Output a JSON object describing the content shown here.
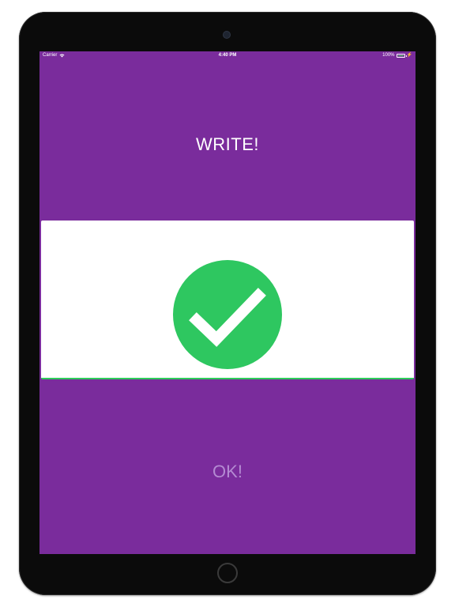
{
  "status_bar": {
    "carrier": "Carrier",
    "time": "4:40 PM",
    "battery_percent": "100%",
    "battery_level": 1.0,
    "wifi_icon": "wifi-icon",
    "charging_icon": "charging-bolt-icon"
  },
  "main": {
    "title": "WRITE!",
    "result_icon": "checkmark-circle-icon",
    "ok_label": "OK!"
  },
  "colors": {
    "background": "#7a2c9c",
    "card": "#ffffff",
    "success": "#2ec760",
    "ok_text": "#b48ad2"
  }
}
